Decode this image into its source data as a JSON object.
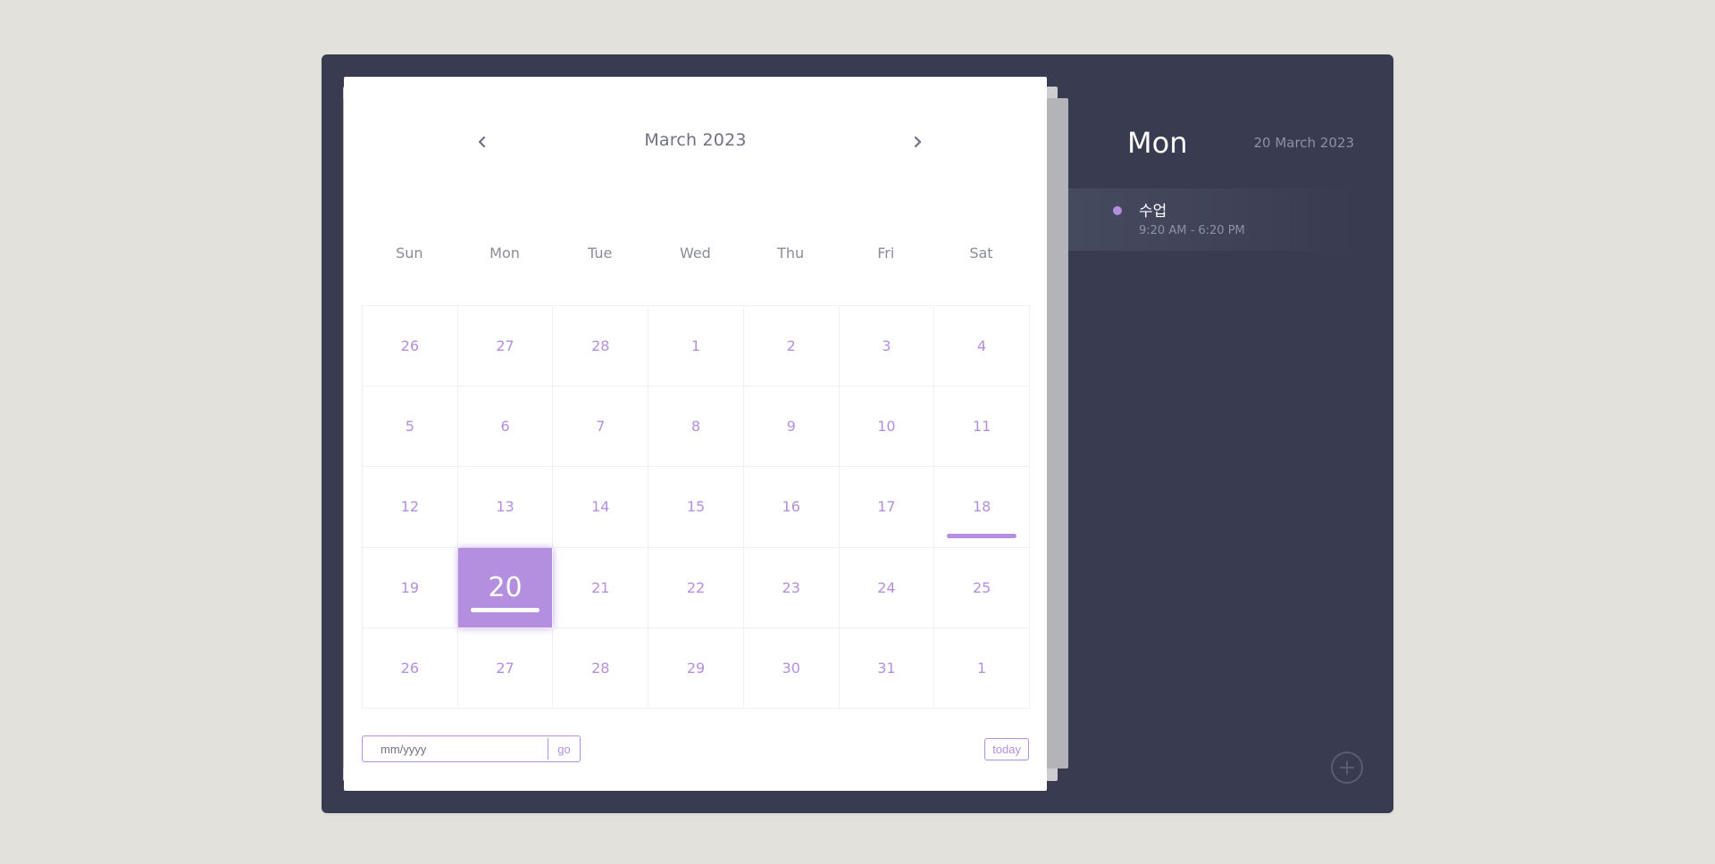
{
  "calendar": {
    "month_title": "March 2023",
    "prev_icon": "chevron-left-icon",
    "next_icon": "chevron-right-icon",
    "weekdays": [
      "Sun",
      "Mon",
      "Tue",
      "Wed",
      "Thu",
      "Fri",
      "Sat"
    ],
    "weeks": [
      [
        "26",
        "27",
        "28",
        "1",
        "2",
        "3",
        "4"
      ],
      [
        "5",
        "6",
        "7",
        "8",
        "9",
        "10",
        "11"
      ],
      [
        "12",
        "13",
        "14",
        "15",
        "16",
        "17",
        "18"
      ],
      [
        "19",
        "20",
        "21",
        "22",
        "23",
        "24",
        "25"
      ],
      [
        "26",
        "27",
        "28",
        "29",
        "30",
        "31",
        "1"
      ]
    ],
    "selected_day": "20",
    "days_with_events": [
      "18",
      "20"
    ],
    "accent_color": "#b48fe0"
  },
  "footer": {
    "date_input_placeholder": "mm/yyyy",
    "go_label": "go",
    "today_label": "today"
  },
  "side": {
    "day_name": "Mon",
    "full_date": "20 March 2023",
    "events": [
      {
        "title": "수업",
        "time": "9:20 AM - 6:20 PM",
        "dot_color": "#b48fe0"
      }
    ],
    "add_icon": "plus-icon"
  }
}
